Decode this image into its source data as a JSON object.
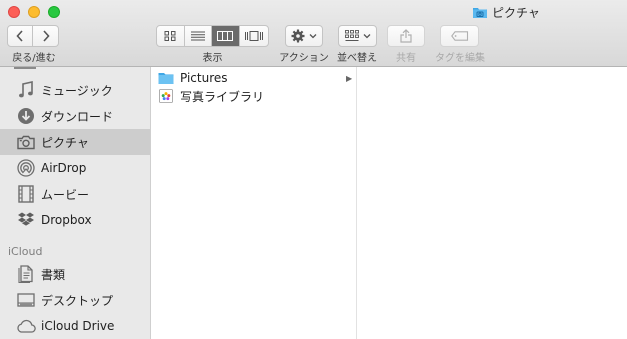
{
  "window": {
    "title": "ピクチャ",
    "title_icon": "camera-folder-icon"
  },
  "toolbar": {
    "nav_label": "戻る/進む",
    "view_label": "表示",
    "action_label": "アクション",
    "arrange_label": "並べ替え",
    "share_label": "共有",
    "tags_label": "タグを編集",
    "active_view": "column"
  },
  "sidebar": {
    "items": [
      {
        "label": "ミュージック",
        "icon": "music-note-icon"
      },
      {
        "label": "ダウンロード",
        "icon": "download-icon"
      },
      {
        "label": "ピクチャ",
        "icon": "camera-icon",
        "selected": true
      },
      {
        "label": "AirDrop",
        "icon": "airdrop-icon"
      },
      {
        "label": "ムービー",
        "icon": "film-icon"
      },
      {
        "label": "Dropbox",
        "icon": "dropbox-icon"
      }
    ],
    "icloud_section": "iCloud",
    "icloud_items": [
      {
        "label": "書類",
        "icon": "document-icon"
      },
      {
        "label": "デスクトップ",
        "icon": "desktop-icon"
      },
      {
        "label": "iCloud Drive",
        "icon": "cloud-icon"
      }
    ]
  },
  "files": [
    {
      "name": "Pictures",
      "icon": "folder-icon",
      "has_children": true
    },
    {
      "name": "写真ライブラリ",
      "icon": "photos-library-icon",
      "has_children": false
    }
  ],
  "colors": {
    "close": "#fc5f57",
    "minimize": "#fdbc2e",
    "maximize": "#28c840",
    "folder_blue": "#5ab8ef",
    "selection": "#cdcdcd"
  }
}
